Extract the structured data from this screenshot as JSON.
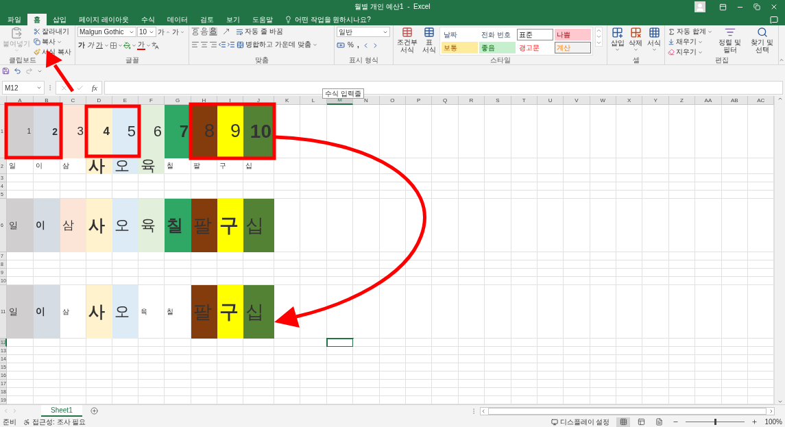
{
  "window": {
    "title": "월별 개인 예산1  -  Excel"
  },
  "tabs": [
    {
      "label": "파일",
      "selected": false
    },
    {
      "label": "홈",
      "selected": true
    },
    {
      "label": "삽입",
      "selected": false
    },
    {
      "label": "페이지 레이아웃",
      "selected": false
    },
    {
      "label": "수식",
      "selected": false
    },
    {
      "label": "데이터",
      "selected": false
    },
    {
      "label": "검토",
      "selected": false
    },
    {
      "label": "보기",
      "selected": false
    },
    {
      "label": "도움말",
      "selected": false
    }
  ],
  "tell_me": {
    "placeholder": "어떤 작업을 원하시나요?"
  },
  "ribbon": {
    "clipboard": {
      "label": "클립보드",
      "paste": {
        "label": "붙여넣기",
        "disabled": true
      },
      "cut": "잘라내기",
      "copy": "복사",
      "format_painter": "서식 복사"
    },
    "font": {
      "label": "글꼴",
      "font_name": "Malgun Gothic",
      "font_size": "10",
      "grow": "가",
      "shrink": "가",
      "bold": "가",
      "italic": "가",
      "underline": "가",
      "font_color": "가"
    },
    "alignment": {
      "label": "맞춤",
      "wrap_text": "자동 줄 바꿈",
      "merge_center": "병합하고 가운데 맞춤"
    },
    "number": {
      "label": "표시 형식",
      "format": "일반",
      "percent": "%",
      "comma": ","
    },
    "styles": {
      "label": "스타일",
      "conditional": "조건부 서식",
      "format_table": "표 서식",
      "gallery": [
        {
          "label": "날짜",
          "kind": "link"
        },
        {
          "label": "전화 번호",
          "kind": "link"
        },
        {
          "label": "표준",
          "kind": "normal"
        },
        {
          "label": "나쁨",
          "kind": "bad"
        },
        {
          "label": "보통",
          "kind": "neutral"
        },
        {
          "label": "좋음",
          "kind": "good"
        },
        {
          "label": "경고문",
          "kind": "warning"
        },
        {
          "label": "계산",
          "kind": "calc"
        }
      ]
    },
    "cells": {
      "label": "셀",
      "insert": "삽입",
      "delete": "삭제",
      "format": "서식"
    },
    "editing": {
      "label": "편집",
      "autosum": "자동 합계",
      "fill": "채우기",
      "clear": "지우기",
      "sort_filter": "정렬 및 필터",
      "find_select": "찾기 및 선택"
    }
  },
  "formula_bar": {
    "name_box": "M12",
    "function_button": "fx",
    "tooltip": "수식 입력줄"
  },
  "sheet": {
    "columns": [
      {
        "label": "A",
        "selected": false
      },
      {
        "label": "B",
        "selected": false
      },
      {
        "label": "C",
        "selected": false
      },
      {
        "label": "D",
        "selected": false
      },
      {
        "label": "E",
        "selected": false
      },
      {
        "label": "F",
        "selected": false
      },
      {
        "label": "G",
        "selected": false
      },
      {
        "label": "H",
        "selected": false
      },
      {
        "label": "I",
        "selected": false
      },
      {
        "label": "J",
        "selected": false
      },
      {
        "label": "K",
        "selected": false
      },
      {
        "label": "L",
        "selected": false
      },
      {
        "label": "M",
        "selected": true
      },
      {
        "label": "N",
        "selected": false
      },
      {
        "label": "O",
        "selected": false
      },
      {
        "label": "P",
        "selected": false
      },
      {
        "label": "Q",
        "selected": false
      },
      {
        "label": "R",
        "selected": false
      },
      {
        "label": "S",
        "selected": false
      },
      {
        "label": "T",
        "selected": false
      },
      {
        "label": "U",
        "selected": false
      },
      {
        "label": "V",
        "selected": false
      },
      {
        "label": "W",
        "selected": false
      },
      {
        "label": "X",
        "selected": false
      },
      {
        "label": "Y",
        "selected": false
      },
      {
        "label": "Z",
        "selected": false
      },
      {
        "label": "AA",
        "selected": false
      },
      {
        "label": "AB",
        "selected": false
      },
      {
        "label": "AC",
        "selected": false
      }
    ],
    "rows": [
      {
        "header": "1",
        "selected": false,
        "kind": "number",
        "cells": [
          {
            "text": "1",
            "kind": "tiny",
            "color": "#d0cece"
          },
          {
            "text": "2",
            "kind": "small-bold",
            "color": "#d6dce4"
          },
          {
            "text": "3",
            "kind": "medium",
            "color": "#fce4d6"
          },
          {
            "text": "4",
            "kind": "medium-bold",
            "color": "#fff2cc"
          },
          {
            "text": "5",
            "kind": "large",
            "color": "#ddebf7"
          },
          {
            "text": "6",
            "kind": "large",
            "color": "#e2efda"
          },
          {
            "text": "7",
            "kind": "large-bold",
            "color": "#2fa866"
          },
          {
            "text": "8",
            "kind": "xlarge",
            "color": "#843c0c"
          },
          {
            "text": "9",
            "kind": "xlarge",
            "color": "#ffff00"
          },
          {
            "text": "10",
            "kind": "heavy",
            "color": "#548235"
          }
        ]
      },
      {
        "header": "2",
        "selected": false,
        "kind": "caption",
        "cells": [
          {
            "text": "일",
            "kind": "tiny"
          },
          {
            "text": "이",
            "kind": "tiny"
          },
          {
            "text": "삼",
            "kind": "tiny"
          },
          {
            "text": "사",
            "kind": "large-bold",
            "color": "#fff2cc"
          },
          {
            "text": "오",
            "kind": "large",
            "color": "#ddebf7"
          },
          {
            "text": "육",
            "kind": "large",
            "color": "#e2efda"
          },
          {
            "text": "칠",
            "kind": "tiny"
          },
          {
            "text": "팔",
            "kind": "tiny"
          },
          {
            "text": "구",
            "kind": "tiny"
          },
          {
            "text": "십",
            "kind": "tiny"
          }
        ]
      },
      {
        "header": "3",
        "selected": false
      },
      {
        "header": "4",
        "selected": false
      },
      {
        "header": "5",
        "selected": false
      },
      {
        "header": "6",
        "selected": false,
        "kind": "text",
        "cells": [
          {
            "text": "일",
            "kind": "small",
            "color": "#d0cece"
          },
          {
            "text": "이",
            "kind": "small-bold",
            "color": "#d6dce4"
          },
          {
            "text": "삼",
            "kind": "medium",
            "color": "#fce4d6"
          },
          {
            "text": "사",
            "kind": "large-bold",
            "color": "#fff2cc"
          },
          {
            "text": "오",
            "kind": "large",
            "color": "#ddebf7"
          },
          {
            "text": "육",
            "kind": "large",
            "color": "#e2efda"
          },
          {
            "text": "칠",
            "kind": "large-bold",
            "color": "#2fa866"
          },
          {
            "text": "팔",
            "kind": "xlarge",
            "color": "#843c0c"
          },
          {
            "text": "구",
            "kind": "heavy",
            "color": "#ffff00"
          },
          {
            "text": "십",
            "kind": "xlarge",
            "color": "#548235"
          }
        ]
      },
      {
        "header": "7",
        "selected": false
      },
      {
        "header": "8",
        "selected": false
      },
      {
        "header": "9",
        "selected": false
      },
      {
        "header": "10",
        "selected": false
      },
      {
        "header": "11",
        "selected": false,
        "kind": "text",
        "cells": [
          {
            "text": "일",
            "kind": "small",
            "color": "#d0cece"
          },
          {
            "text": "이",
            "kind": "small-bold",
            "color": "#d6dce4"
          },
          {
            "text": "삼",
            "kind": "tiny"
          },
          {
            "text": "사",
            "kind": "large-bold",
            "color": "#fff2cc"
          },
          {
            "text": "오",
            "kind": "large",
            "color": "#ddebf7"
          },
          {
            "text": "육",
            "kind": "tiny"
          },
          {
            "text": "칠",
            "kind": "tiny"
          },
          {
            "text": "팔",
            "kind": "xlarge",
            "color": "#843c0c"
          },
          {
            "text": "구",
            "kind": "heavy",
            "color": "#ffff00"
          },
          {
            "text": "십",
            "kind": "xlarge",
            "color": "#548235"
          }
        ]
      },
      {
        "header": "12",
        "selected": true
      },
      {
        "header": "13",
        "selected": false
      },
      {
        "header": "14",
        "selected": false
      },
      {
        "header": "15",
        "selected": false
      },
      {
        "header": "16",
        "selected": false
      },
      {
        "header": "17",
        "selected": false
      },
      {
        "header": "18",
        "selected": false
      },
      {
        "header": "19",
        "selected": false
      }
    ]
  },
  "sheet_tabs": [
    {
      "label": "Sheet1",
      "selected": true
    }
  ],
  "status_bar": {
    "ready": "준비",
    "accessibility": "접근성: 조사 필요",
    "display_settings": "디스플레이 설정",
    "views": [
      {
        "kind": "normal",
        "selected": true
      },
      {
        "kind": "layout",
        "selected": false
      },
      {
        "kind": "preview",
        "selected": false
      }
    ],
    "zoom": {
      "level": 0.5,
      "reading": "100%"
    }
  }
}
